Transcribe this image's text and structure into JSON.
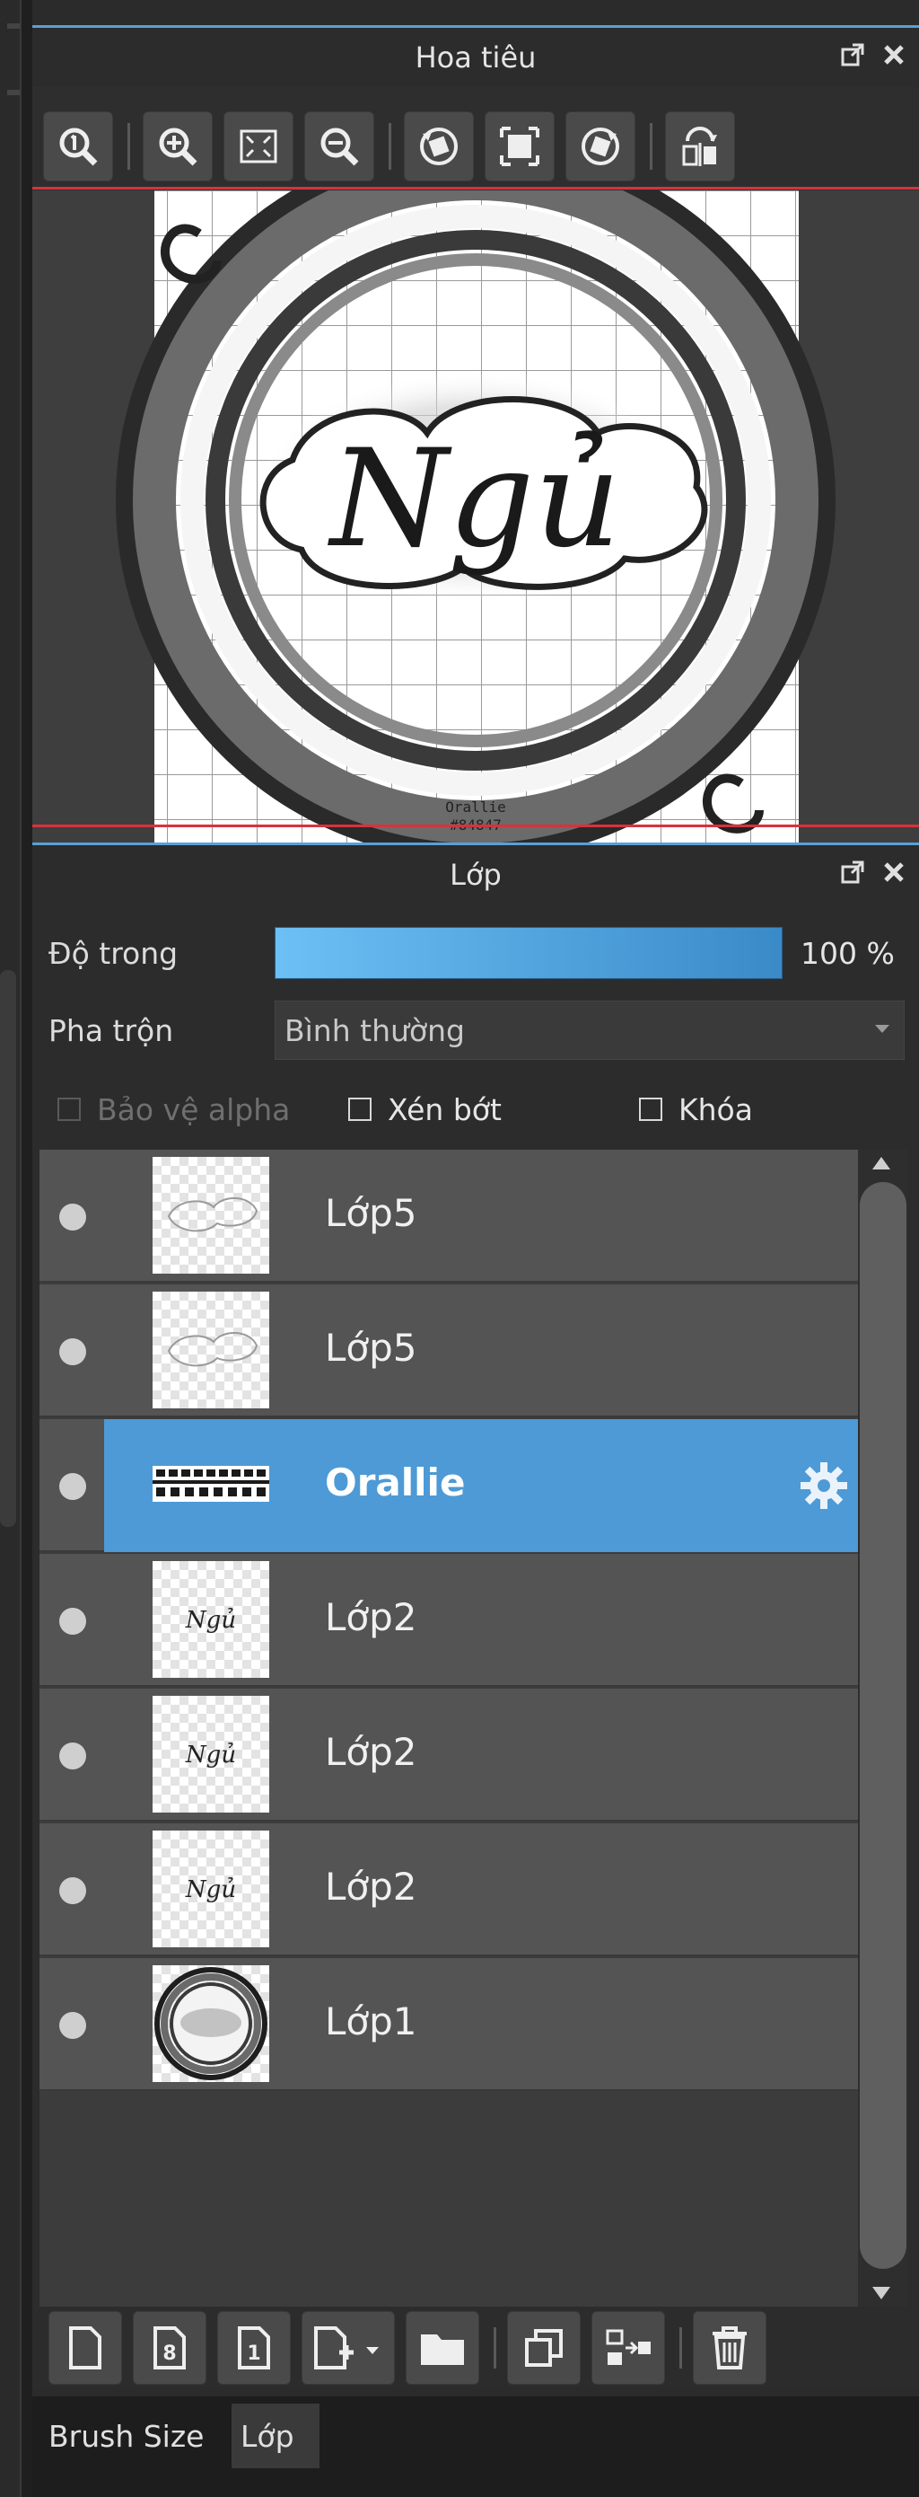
{
  "navigator": {
    "title": "Hoa tiêu",
    "toolbar": [
      {
        "name": "zoom-100-icon"
      },
      {
        "name": "zoom-in-icon"
      },
      {
        "name": "fit-screen-icon"
      },
      {
        "name": "zoom-out-icon"
      },
      {
        "name": "rotate-left-icon"
      },
      {
        "name": "fit-canvas-icon"
      },
      {
        "name": "rotate-right-icon"
      },
      {
        "name": "flip-horizontal-icon"
      }
    ],
    "preview": {
      "main_text": "Ngủ",
      "watermark_line1": "Orallie",
      "watermark_line2": "#84847"
    }
  },
  "layers": {
    "title": "Lớp",
    "opacity_label": "Độ trong",
    "opacity_value": "100 %",
    "opacity_fraction": 1.0,
    "blend_label": "Pha trộn",
    "blend_value": "Bình thường",
    "protect_alpha": "Bảo vệ alpha",
    "clipping": "Xén bớt",
    "lock": "Khóa",
    "items": [
      {
        "name": "Lớp5",
        "selected": false
      },
      {
        "name": "Lớp5",
        "selected": false
      },
      {
        "name": "Orallie",
        "selected": true
      },
      {
        "name": "Lớp2",
        "selected": false
      },
      {
        "name": "Lớp2",
        "selected": false
      },
      {
        "name": "Lớp2",
        "selected": false
      },
      {
        "name": "Lớp1",
        "selected": false
      }
    ]
  },
  "tabs": {
    "brush_size": "Brush Size",
    "layer": "Lớp"
  },
  "colors": {
    "accent": "#4d9ad6",
    "header_line": "#5aa0d6",
    "red_line": "#d6333b"
  }
}
